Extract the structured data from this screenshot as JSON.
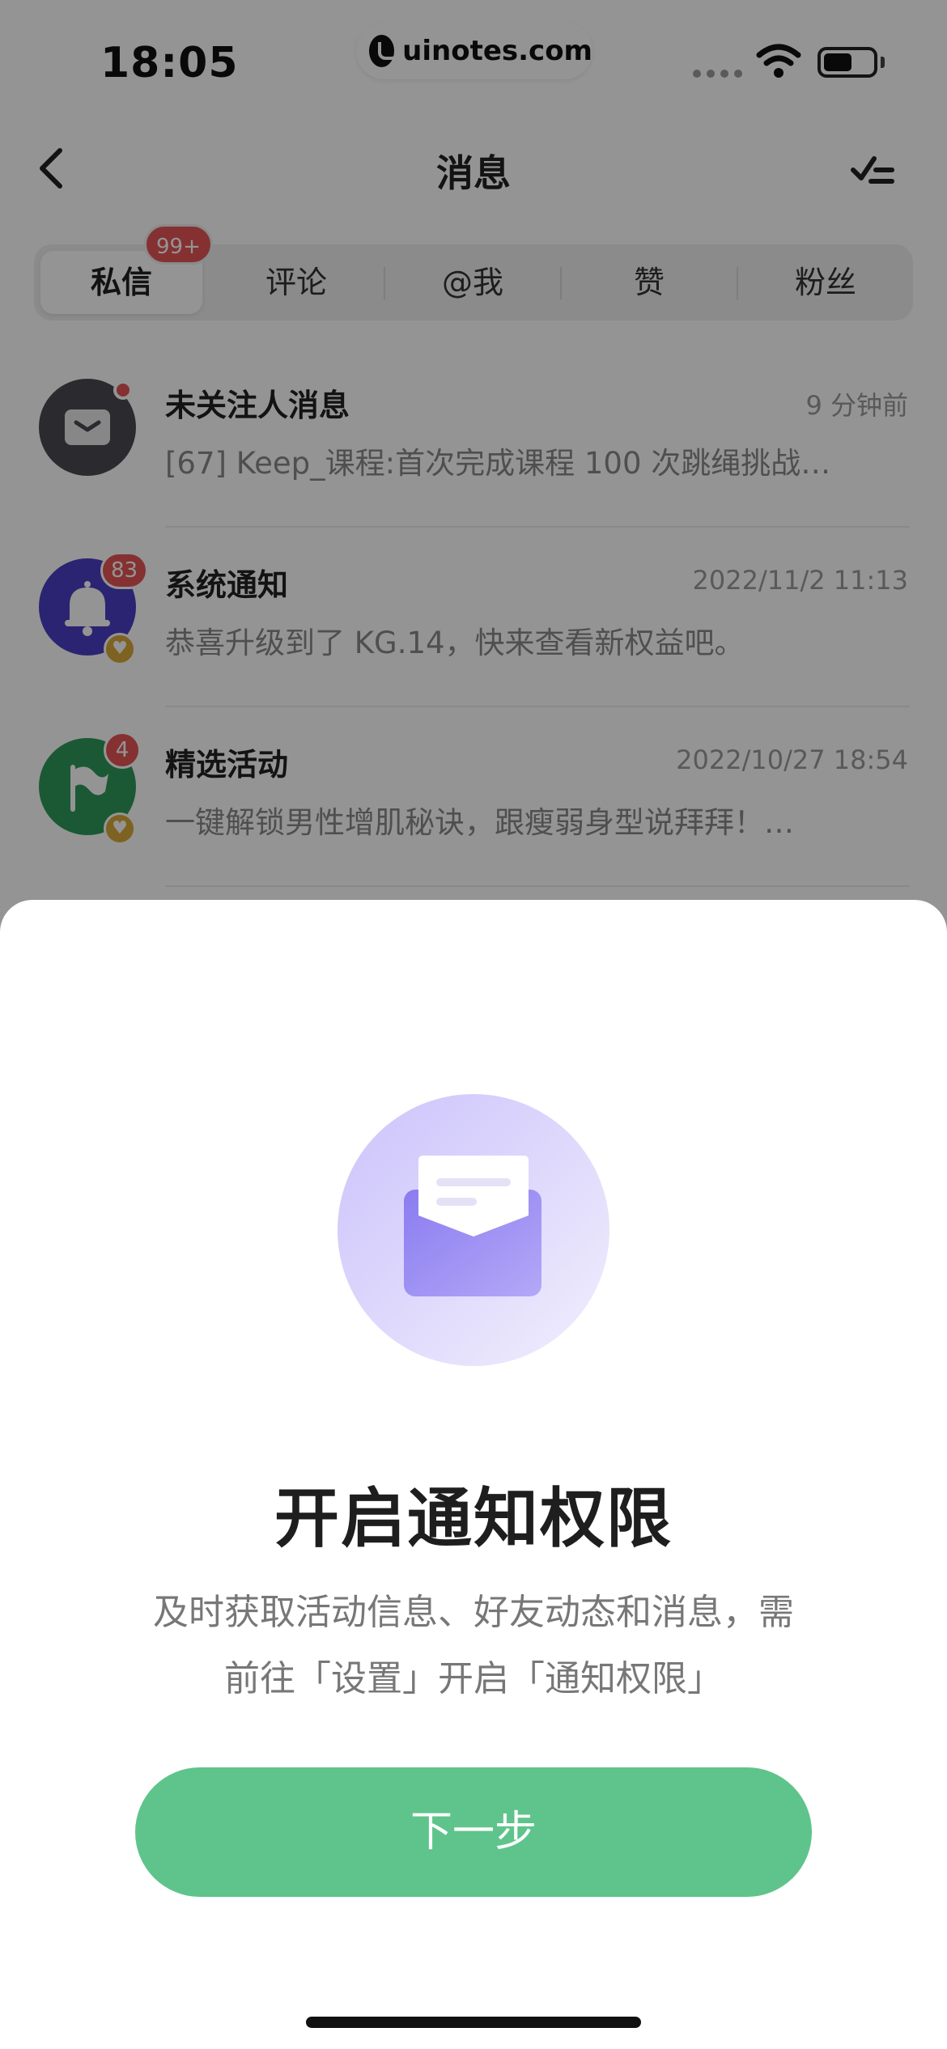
{
  "status_bar": {
    "time": "18:05",
    "watermark": "uinotes.com"
  },
  "nav": {
    "title": "消息",
    "back_icon": "chevron-left-icon",
    "read_all_icon": "mark-all-read-icon"
  },
  "tabs": [
    {
      "label": "私信",
      "active": true,
      "badge": "99+"
    },
    {
      "label": "评论",
      "active": false
    },
    {
      "label": "@我",
      "active": false
    },
    {
      "label": "赞",
      "active": false
    },
    {
      "label": "粉丝",
      "active": false
    }
  ],
  "messages": [
    {
      "title": "未关注人消息",
      "time": "9 分钟前",
      "preview": "[67] Keep_课程:首次完成课程 100 次跳绳挑战…",
      "avatar_color": "#4a4a52",
      "icon": "envelope-icon",
      "unread_dot": true
    },
    {
      "title": "系统通知",
      "time": "2022/11/2 11:13",
      "preview": "恭喜升级到了 KG.14，快来查看新权益吧。",
      "avatar_color": "#4b3fc4",
      "icon": "bell-icon",
      "badge": "83"
    },
    {
      "title": "精选活动",
      "time": "2022/10/27 18:54",
      "preview": "一键解锁男性增肌秘诀，跟瘦弱身型说拜拜！…",
      "avatar_color": "#2e9a5a",
      "icon": "flag-icon",
      "badge": "4"
    }
  ],
  "sheet": {
    "icon": "open-envelope-icon",
    "title": "开启通知权限",
    "desc_line1": "及时获取活动信息、好友动态和消息，需",
    "desc_line2": "前往「设置」开启「通知权限」",
    "button_label": "下一步"
  },
  "colors": {
    "accent_green": "#5ec48b",
    "badge_red": "#e65555",
    "envelope_purple": "#8a7cf0"
  }
}
